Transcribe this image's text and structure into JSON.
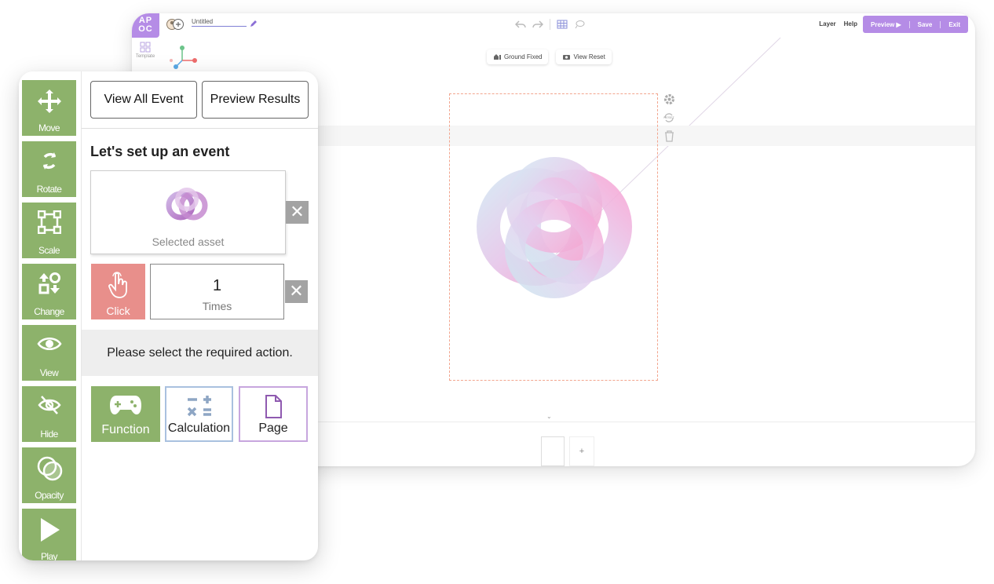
{
  "editor": {
    "logo": [
      "AP",
      "OC"
    ],
    "document_title": "Untitled",
    "menu": [
      "Layer",
      "Help"
    ],
    "actions": {
      "preview": "Preview ▶",
      "save": "Save",
      "exit": "Exit"
    },
    "sidebar_template": "Template",
    "view_buttons": {
      "ground_fixed": "Ground Fixed",
      "view_reset": "View Reset"
    },
    "reset_icon_text": "RESET",
    "page_add": "+",
    "collapse": "⌄"
  },
  "panel": {
    "tools": [
      "Move",
      "Rotate",
      "Scale",
      "Change",
      "View",
      "Hide",
      "Opacity",
      "Play"
    ],
    "view_all_event": "View All Event",
    "preview_results": "Preview Results",
    "heading": "Let's set up an event",
    "selected_asset_label": "Selected asset",
    "remove_symbol": "✕",
    "trigger_label": "Click",
    "times_value": "1",
    "times_label": "Times",
    "instruction": "Please select the required action.",
    "actions": [
      "Function",
      "Calculation",
      "Page"
    ]
  },
  "colors": {
    "tool_green": "#8db26b",
    "click_red": "#e88f8b",
    "brand_purple": "#b58ce6",
    "calc_border": "#a9c1df",
    "page_border": "#c7a6de"
  }
}
